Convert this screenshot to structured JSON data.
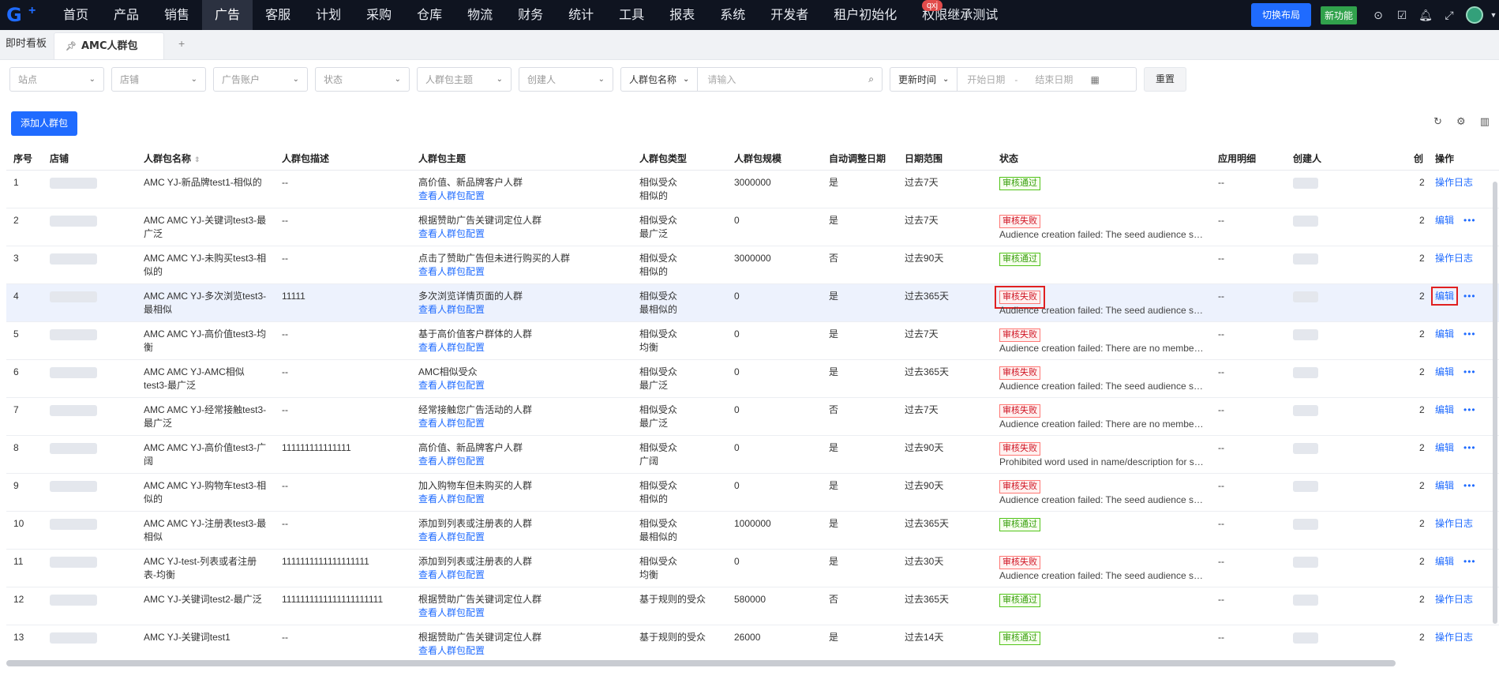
{
  "nav": {
    "items": [
      "首页",
      "产品",
      "销售",
      "广告",
      "客服",
      "计划",
      "采购",
      "仓库",
      "物流",
      "财务",
      "统计",
      "工具",
      "报表",
      "系统",
      "开发者",
      "租户初始化",
      "权限继承测试"
    ],
    "active": "广告",
    "user_badge": "qxj",
    "switch_layout": "切换布局",
    "new_feature": "新功能"
  },
  "tabs": {
    "dashboard": "即时看板",
    "active": "AMC人群包",
    "add": "+"
  },
  "filters": {
    "site": "站点",
    "shop": "店铺",
    "ad_account": "广告账户",
    "status": "状态",
    "theme": "人群包主题",
    "creator": "创建人",
    "name_field": "人群包名称",
    "name_placeholder": "请输入",
    "time_field": "更新时间",
    "start_date": "开始日期",
    "sep": "-",
    "end_date": "结束日期",
    "reset": "重置"
  },
  "add_button": "添加人群包",
  "table": {
    "columns": [
      "序号",
      "店铺",
      "人群包名称",
      "人群包描述",
      "人群包主题",
      "人群包类型",
      "人群包规模",
      "自动调整日期",
      "日期范围",
      "状态",
      "应用明细",
      "创建人",
      "创",
      "操作"
    ],
    "view_config": "查看人群包配置",
    "rows": [
      {
        "no": "1",
        "name": "AMC YJ-新品牌test1-相似的",
        "desc": "--",
        "theme": "高价值、新品牌客户人群",
        "type1": "相似受众",
        "type2": "相似的",
        "size": "3000000",
        "auto": "是",
        "range": "过去7天",
        "status": "审核通过",
        "ok": true,
        "err": "",
        "app": "--",
        "c": "2",
        "op": "操作日志",
        "more": false
      },
      {
        "no": "2",
        "name": "AMC AMC YJ-关键词test3-最广泛",
        "desc": "--",
        "theme": "根据赞助广告关键词定位人群",
        "type1": "相似受众",
        "type2": "最广泛",
        "size": "0",
        "auto": "是",
        "range": "过去7天",
        "status": "审核失败",
        "ok": false,
        "err": "Audience creation failed: The seed audience size is too small",
        "app": "--",
        "c": "2",
        "op": "编辑",
        "more": true
      },
      {
        "no": "3",
        "name": "AMC AMC YJ-未购买test3-相似的",
        "desc": "--",
        "theme": "点击了赞助广告但未进行购买的人群",
        "type1": "相似受众",
        "type2": "相似的",
        "size": "3000000",
        "auto": "否",
        "range": "过去90天",
        "status": "审核通过",
        "ok": true,
        "err": "",
        "app": "--",
        "c": "2",
        "op": "操作日志",
        "more": false
      },
      {
        "no": "4",
        "name": "AMC AMC YJ-多次浏览test3-最相似",
        "desc": "11111",
        "theme": "多次浏览详情页面的人群",
        "type1": "相似受众",
        "type2": "最相似的",
        "size": "0",
        "auto": "是",
        "range": "过去365天",
        "status": "审核失败",
        "ok": false,
        "err": "Audience creation failed: The seed audience size is too small",
        "app": "--",
        "c": "2",
        "op": "编辑",
        "more": true,
        "hl": true
      },
      {
        "no": "5",
        "name": "AMC AMC YJ-高价值test3-均衡",
        "desc": "--",
        "theme": "基于高价值客户群体的人群",
        "type1": "相似受众",
        "type2": "均衡",
        "size": "0",
        "auto": "是",
        "range": "过去7天",
        "status": "审核失败",
        "ok": false,
        "err": "Audience creation failed: There are no members in the seed audience",
        "app": "--",
        "c": "2",
        "op": "编辑",
        "more": true
      },
      {
        "no": "6",
        "name": "AMC AMC YJ-AMC相似test3-最广泛",
        "desc": "--",
        "theme": "AMC相似受众",
        "type1": "相似受众",
        "type2": "最广泛",
        "size": "0",
        "auto": "是",
        "range": "过去365天",
        "status": "审核失败",
        "ok": false,
        "err": "Audience creation failed: The seed audience size is too small",
        "app": "--",
        "c": "2",
        "op": "编辑",
        "more": true
      },
      {
        "no": "7",
        "name": "AMC AMC YJ-经常接触test3-最广泛",
        "desc": "--",
        "theme": "经常接触您广告活动的人群",
        "type1": "相似受众",
        "type2": "最广泛",
        "size": "0",
        "auto": "否",
        "range": "过去7天",
        "status": "审核失败",
        "ok": false,
        "err": "Audience creation failed: There are no members in the seed audience",
        "app": "--",
        "c": "2",
        "op": "编辑",
        "more": true
      },
      {
        "no": "8",
        "name": "AMC AMC YJ-高价值test3-广阔",
        "desc": "111111111111111",
        "theme": "高价值、新品牌客户人群",
        "type1": "相似受众",
        "type2": "广阔",
        "size": "0",
        "auto": "是",
        "range": "过去90天",
        "status": "审核失败",
        "ok": false,
        "err": "Prohibited word used in name/description for submission",
        "app": "--",
        "c": "2",
        "op": "编辑",
        "more": true
      },
      {
        "no": "9",
        "name": "AMC AMC YJ-购物车test3-相似的",
        "desc": "--",
        "theme": "加入购物车但未购买的人群",
        "type1": "相似受众",
        "type2": "相似的",
        "size": "0",
        "auto": "是",
        "range": "过去90天",
        "status": "审核失败",
        "ok": false,
        "err": "Audience creation failed: The seed audience size is too small",
        "app": "--",
        "c": "2",
        "op": "编辑",
        "more": true
      },
      {
        "no": "10",
        "name": "AMC AMC YJ-注册表test3-最相似",
        "desc": "--",
        "theme": "添加到列表或注册表的人群",
        "type1": "相似受众",
        "type2": "最相似的",
        "size": "1000000",
        "auto": "是",
        "range": "过去365天",
        "status": "审核通过",
        "ok": true,
        "err": "",
        "app": "--",
        "c": "2",
        "op": "操作日志",
        "more": false
      },
      {
        "no": "11",
        "name": "AMC YJ-test-列表或者注册表-均衡",
        "desc": "1111111111111111111",
        "theme": "添加到列表或注册表的人群",
        "type1": "相似受众",
        "type2": "均衡",
        "size": "0",
        "auto": "是",
        "range": "过去30天",
        "status": "审核失败",
        "ok": false,
        "err": "Audience creation failed: The seed audience size is too small",
        "app": "--",
        "c": "2",
        "op": "编辑",
        "more": true
      },
      {
        "no": "12",
        "name": "AMC YJ-关键词test2-最广泛",
        "desc": "1111111111111111111111",
        "theme": "根据赞助广告关键词定位人群",
        "type1": "基于规则的受众",
        "type2": "",
        "size": "580000",
        "auto": "否",
        "range": "过去365天",
        "status": "审核通过",
        "ok": true,
        "err": "",
        "app": "--",
        "c": "2",
        "op": "操作日志",
        "more": false
      },
      {
        "no": "13",
        "name": "AMC YJ-关键词test1",
        "desc": "--",
        "theme": "根据赞助广告关键词定位人群",
        "type1": "基于规则的受众",
        "type2": "",
        "size": "26000",
        "auto": "是",
        "range": "过去14天",
        "status": "审核通过",
        "ok": true,
        "err": "",
        "app": "--",
        "c": "2",
        "op": "操作日志",
        "more": false
      }
    ]
  },
  "colors": {
    "primary": "#1f6bff",
    "nav_bg": "#0f1420",
    "success": "#52c41a",
    "danger": "#ff4d4f"
  }
}
